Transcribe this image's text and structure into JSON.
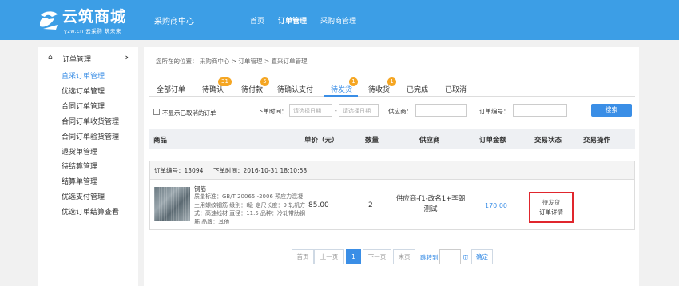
{
  "header": {
    "logo_text": "云筑商城",
    "logo_sub": "yzw.cn 云采购 筑未来",
    "center_title": "采购商中心",
    "nav": [
      {
        "label": "首页"
      },
      {
        "label": "订单管理"
      },
      {
        "label": "采购商管理"
      }
    ],
    "bg_color": "#3c9ee6"
  },
  "sidebar": {
    "section_title": "订单管理",
    "section_icon": "home-icon",
    "items": [
      {
        "label": "直采订单管理",
        "active": true
      },
      {
        "label": "优选订单管理"
      },
      {
        "label": "合同订单管理"
      },
      {
        "label": "合同订单收货管理"
      },
      {
        "label": "合同订单验货管理"
      },
      {
        "label": "退货单管理"
      },
      {
        "label": "待结算管理"
      },
      {
        "label": "结算单管理"
      },
      {
        "label": "优选支付管理"
      },
      {
        "label": "优选订单结算查看"
      }
    ]
  },
  "breadcrumb": "您所在的位置： 采购商中心 > 订单管理 > 直采订单管理",
  "tabs": [
    {
      "label": "全部订单"
    },
    {
      "label": "待确认",
      "badge": "31"
    },
    {
      "label": "待付款",
      "badge": "5"
    },
    {
      "label": "待确认支付"
    },
    {
      "label": "待发货",
      "badge": "1",
      "active": true
    },
    {
      "label": "待收货",
      "badge": "1"
    },
    {
      "label": "已完成"
    },
    {
      "label": "已取消"
    }
  ],
  "filters": {
    "hide_cancelled_label": "不显示已取消的订单",
    "order_time_label": "下单时间：",
    "date_from_placeholder": "请选择日期",
    "date_sep": "-",
    "date_to_placeholder": "请选择日期",
    "supplier_label": "供应商：",
    "order_no_label": "订单编号：",
    "search_label": "搜索"
  },
  "table": {
    "columns": [
      "商品",
      "单价（元）",
      "数量",
      "供应商",
      "订单金额",
      "交易状态",
      "交易操作"
    ]
  },
  "order": {
    "order_no": "订单编号：13094",
    "order_time": "下单时间：2016-10-31 18:10:58",
    "product_name": "钢筋",
    "product_desc": "质量标准：GB/T 20065 -2006 预应力混凝土用螺纹钢筋 级别：Ⅰ级 定尺长度：9 轧机方式：高速线材 直径：11.5 品种：冷轧带肋钢筋 品牌：其他",
    "unit_price": "85.00",
    "quantity": "2",
    "supplier": "供应商-f1-改名1+李朗测试",
    "amount": "170.00",
    "status": "待发货",
    "detail_link": "订单详情"
  },
  "pagination": {
    "first": "首页",
    "prev": "上一页",
    "current": "1",
    "next": "下一页",
    "last": "末页",
    "jump_label": "跳转到",
    "page_unit": "页",
    "confirm": "确定"
  },
  "colors": {
    "accent": "#3a8ee6",
    "badge": "#f5a623",
    "highlight": "#e0262d"
  }
}
